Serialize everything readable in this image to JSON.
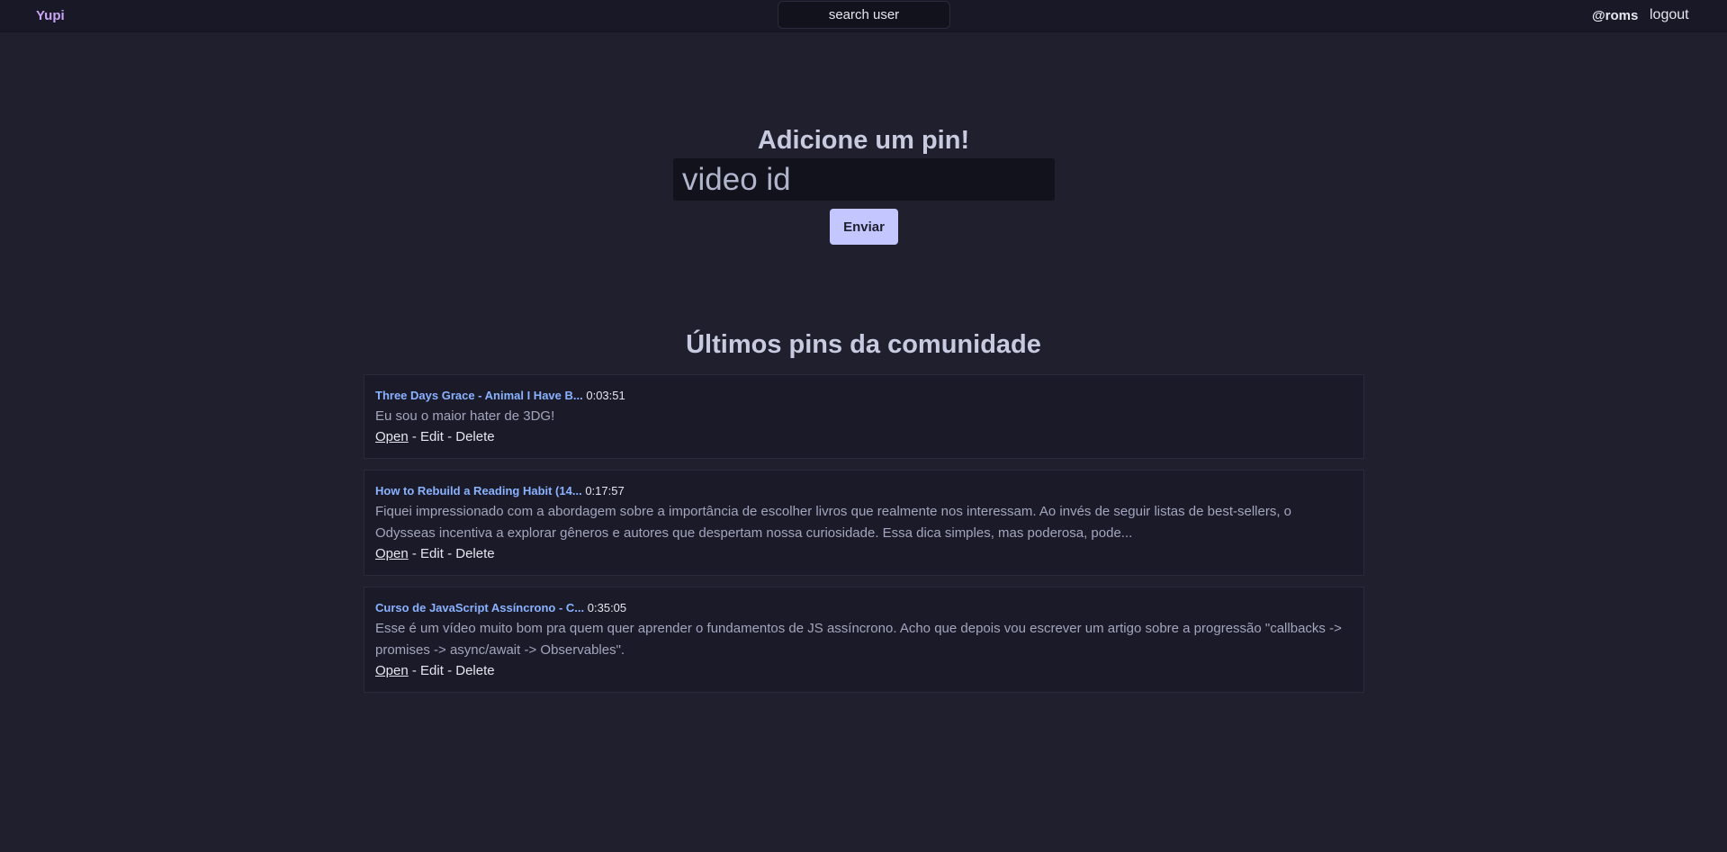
{
  "header": {
    "brand": "Yupi",
    "search_placeholder": "search user",
    "username": "@roms",
    "logout": "logout"
  },
  "add_pin": {
    "title": "Adicione um pin!",
    "input_placeholder": "video id",
    "submit_label": "Enviar"
  },
  "pins_section": {
    "title": "Últimos pins da comunidade",
    "pins": [
      {
        "video_title": "Three Days Grace - Animal I Have B...",
        "timestamp": "0:03:51",
        "comment": "Eu sou o maior hater de 3DG!",
        "open": "Open",
        "edit": "Edit",
        "delete": "Delete"
      },
      {
        "video_title": "How to Rebuild a Reading Habit (14...",
        "timestamp": "0:17:57",
        "comment": "Fiquei impressionado com a abordagem sobre a importância de escolher livros que realmente nos interessam. Ao invés de seguir listas de best-sellers, o Odysseas incentiva a explorar gêneros e autores que despertam nossa curiosidade. Essa dica simples, mas poderosa, pode...",
        "open": "Open",
        "edit": "Edit",
        "delete": "Delete"
      },
      {
        "video_title": "Curso de JavaScript Assíncrono - C...",
        "timestamp": "0:35:05",
        "comment": "Esse é um vídeo muito bom pra quem quer aprender o fundamentos de JS assíncrono. Acho que depois vou escrever um artigo sobre a progressão \"callbacks -> promises -> async/await -> Observables\".",
        "open": "Open",
        "edit": "Edit",
        "delete": "Delete"
      }
    ]
  },
  "colors": {
    "background": "#1f1f2e",
    "topbar": "#181826",
    "brand": "#c9a6f5",
    "link": "#8ab2ff",
    "button": "#c4c7ff"
  }
}
